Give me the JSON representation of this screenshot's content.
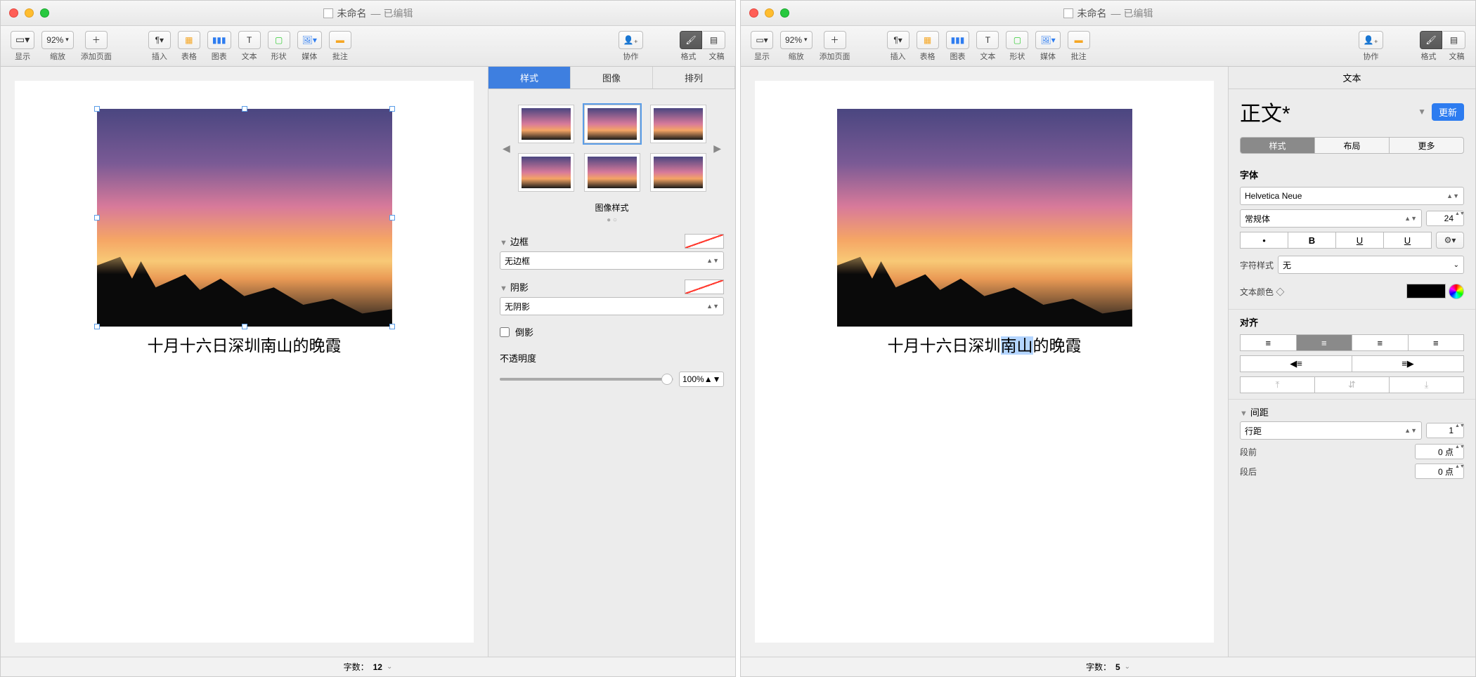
{
  "w1": {
    "title_doc": "未命名",
    "title_suffix": "— 已编辑",
    "toolbar": {
      "view": "显示",
      "zoom": "缩放",
      "zoom_val": "92%",
      "addpage": "添加页面",
      "insert": "插入",
      "table": "表格",
      "chart": "图表",
      "text": "文本",
      "shape": "形状",
      "media": "媒体",
      "annot": "批注",
      "collab": "协作",
      "format": "格式",
      "doc": "文稿"
    },
    "caption": "十月十六日深圳南山的晚霞",
    "status_label": "字数：",
    "status_val": "12",
    "insp": {
      "tabs": [
        "样式",
        "图像",
        "排列"
      ],
      "img_style_label": "图像样式",
      "border": "边框",
      "border_val": "无边框",
      "shadow": "阴影",
      "shadow_val": "无阴影",
      "reflect": "倒影",
      "opacity": "不透明度",
      "opacity_val": "100%"
    }
  },
  "w2": {
    "title_doc": "未命名",
    "title_suffix": "— 已编辑",
    "toolbar": {
      "view": "显示",
      "zoom": "缩放",
      "zoom_val": "92%",
      "addpage": "添加页面",
      "insert": "插入",
      "table": "表格",
      "chart": "图表",
      "text": "文本",
      "shape": "形状",
      "media": "媒体",
      "annot": "批注",
      "collab": "协作",
      "format": "格式",
      "doc": "文稿"
    },
    "caption_pre": "十月十六日深圳",
    "caption_sel": "南山",
    "caption_post": "的晚霞",
    "status_label": "字数：",
    "status_val": "5",
    "insp": {
      "header": "文本",
      "style_name": "正文*",
      "update": "更新",
      "tabs": [
        "样式",
        "布局",
        "更多"
      ],
      "font_h": "字体",
      "font_name": "Helvetica Neue",
      "font_weight": "常规体",
      "font_size": "24",
      "char_style_label": "字符样式",
      "char_style_val": "无",
      "color_label": "文本颜色 ◇",
      "align_h": "对齐",
      "spacing_h": "间距",
      "line_sp_label": "行距",
      "line_sp_val": "1",
      "before_label": "段前",
      "before_val": "0 点",
      "after_label": "段后",
      "after_val": "0 点"
    }
  }
}
